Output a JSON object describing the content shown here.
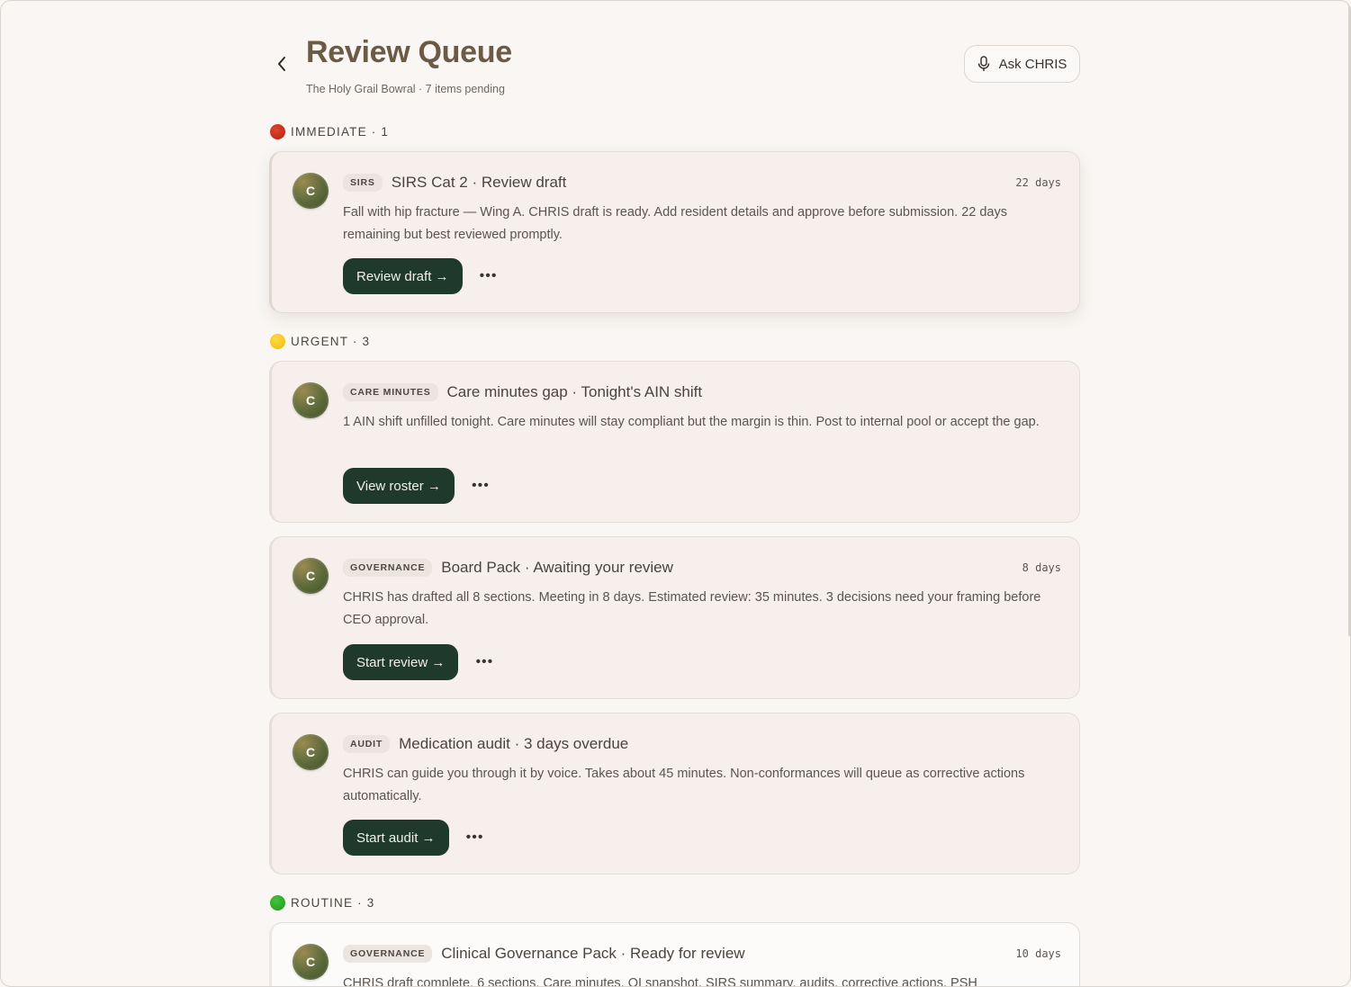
{
  "header": {
    "title": "Review Queue",
    "subtitle": "The Holy Grail Bowral · 7 items pending",
    "ask_label": "Ask CHRIS"
  },
  "sections": {
    "immediate": {
      "label": "IMMEDIATE · 1",
      "color": "#d93a26"
    },
    "urgent": {
      "label": "URGENT · 3",
      "color": "#f5c400"
    },
    "routine": {
      "label": "ROUTINE · 3",
      "color": "#2eb128"
    }
  },
  "cards": [
    {
      "avatar": "C",
      "tag": "SIRS",
      "title": "SIRS Cat 2 · Review draft",
      "days": "22 days",
      "body": "Fall with hip fracture — Wing A. CHRIS draft is ready. Add resident details and approve before submission. 22 days remaining but best reviewed promptly.",
      "action": "Review draft →",
      "more": "•••"
    },
    {
      "avatar": "C",
      "tag": "CARE MINUTES",
      "title": "Care minutes gap · Tonight's AIN shift",
      "days": "",
      "body": "1 AIN shift unfilled tonight. Care minutes will stay compliant but the margin is thin. Post to internal pool or accept the gap.",
      "action": "View roster →",
      "more": "•••"
    },
    {
      "avatar": "C",
      "tag": "GOVERNANCE",
      "title": "Board Pack · Awaiting your review",
      "days": "8 days",
      "body": "CHRIS has drafted all 8 sections. Meeting in 8 days. Estimated review: 35 minutes. 3 decisions need your framing before CEO approval.",
      "action": "Start review →",
      "more": "•••"
    },
    {
      "avatar": "C",
      "tag": "AUDIT",
      "title": "Medication audit · 3 days overdue",
      "days": "",
      "body": "CHRIS can guide you through it by voice. Takes about 45 minutes. Non-conformances will queue as corrective actions automatically.",
      "action": "Start audit →",
      "more": "•••"
    },
    {
      "avatar": "C",
      "tag": "GOVERNANCE",
      "title": "Clinical Governance Pack · Ready for review",
      "days": "10 days",
      "body": "CHRIS draft complete. 6 sections. Care minutes, QI snapshot, SIRS summary, audits, corrective actions, PSH"
    }
  ]
}
